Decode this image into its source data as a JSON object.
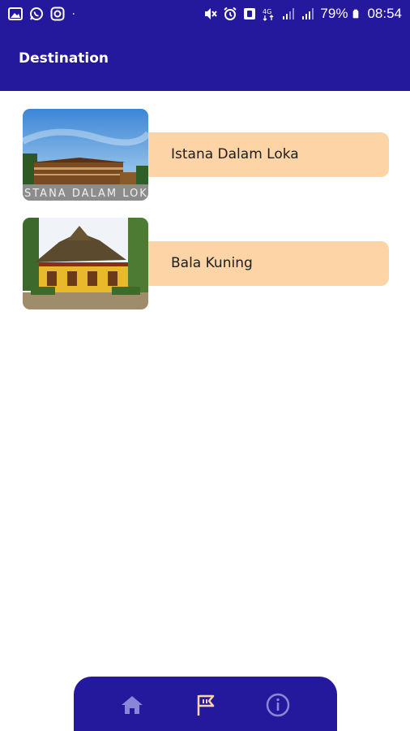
{
  "status_bar": {
    "left_icons": [
      "gallery-icon",
      "whatsapp-icon",
      "instagram-icon",
      "dot-icon"
    ],
    "right_icons": [
      "mute-icon",
      "alarm-icon",
      "nfc-icon",
      "4g-icon",
      "signal-icon",
      "signal-icon-2",
      "battery-icon"
    ],
    "battery": "79%",
    "time": "08:54"
  },
  "app_bar": {
    "title": "Destination"
  },
  "destinations": [
    {
      "name": "Istana Dalam Loka",
      "thumb_icon": "istana-dalam-loka-photo"
    },
    {
      "name": "Bala Kuning",
      "thumb_icon": "bala-kuning-photo"
    }
  ],
  "bottom_nav": {
    "items": [
      {
        "icon": "home-icon",
        "active": false
      },
      {
        "icon": "flag-icon",
        "active": true
      },
      {
        "icon": "info-icon",
        "active": false
      }
    ]
  },
  "colors": {
    "primary": "#24189c",
    "card_label_bg": "#fcd4a6",
    "nav_icon_inactive": "#8a86d6",
    "nav_icon_active": "#fcd4a6"
  }
}
